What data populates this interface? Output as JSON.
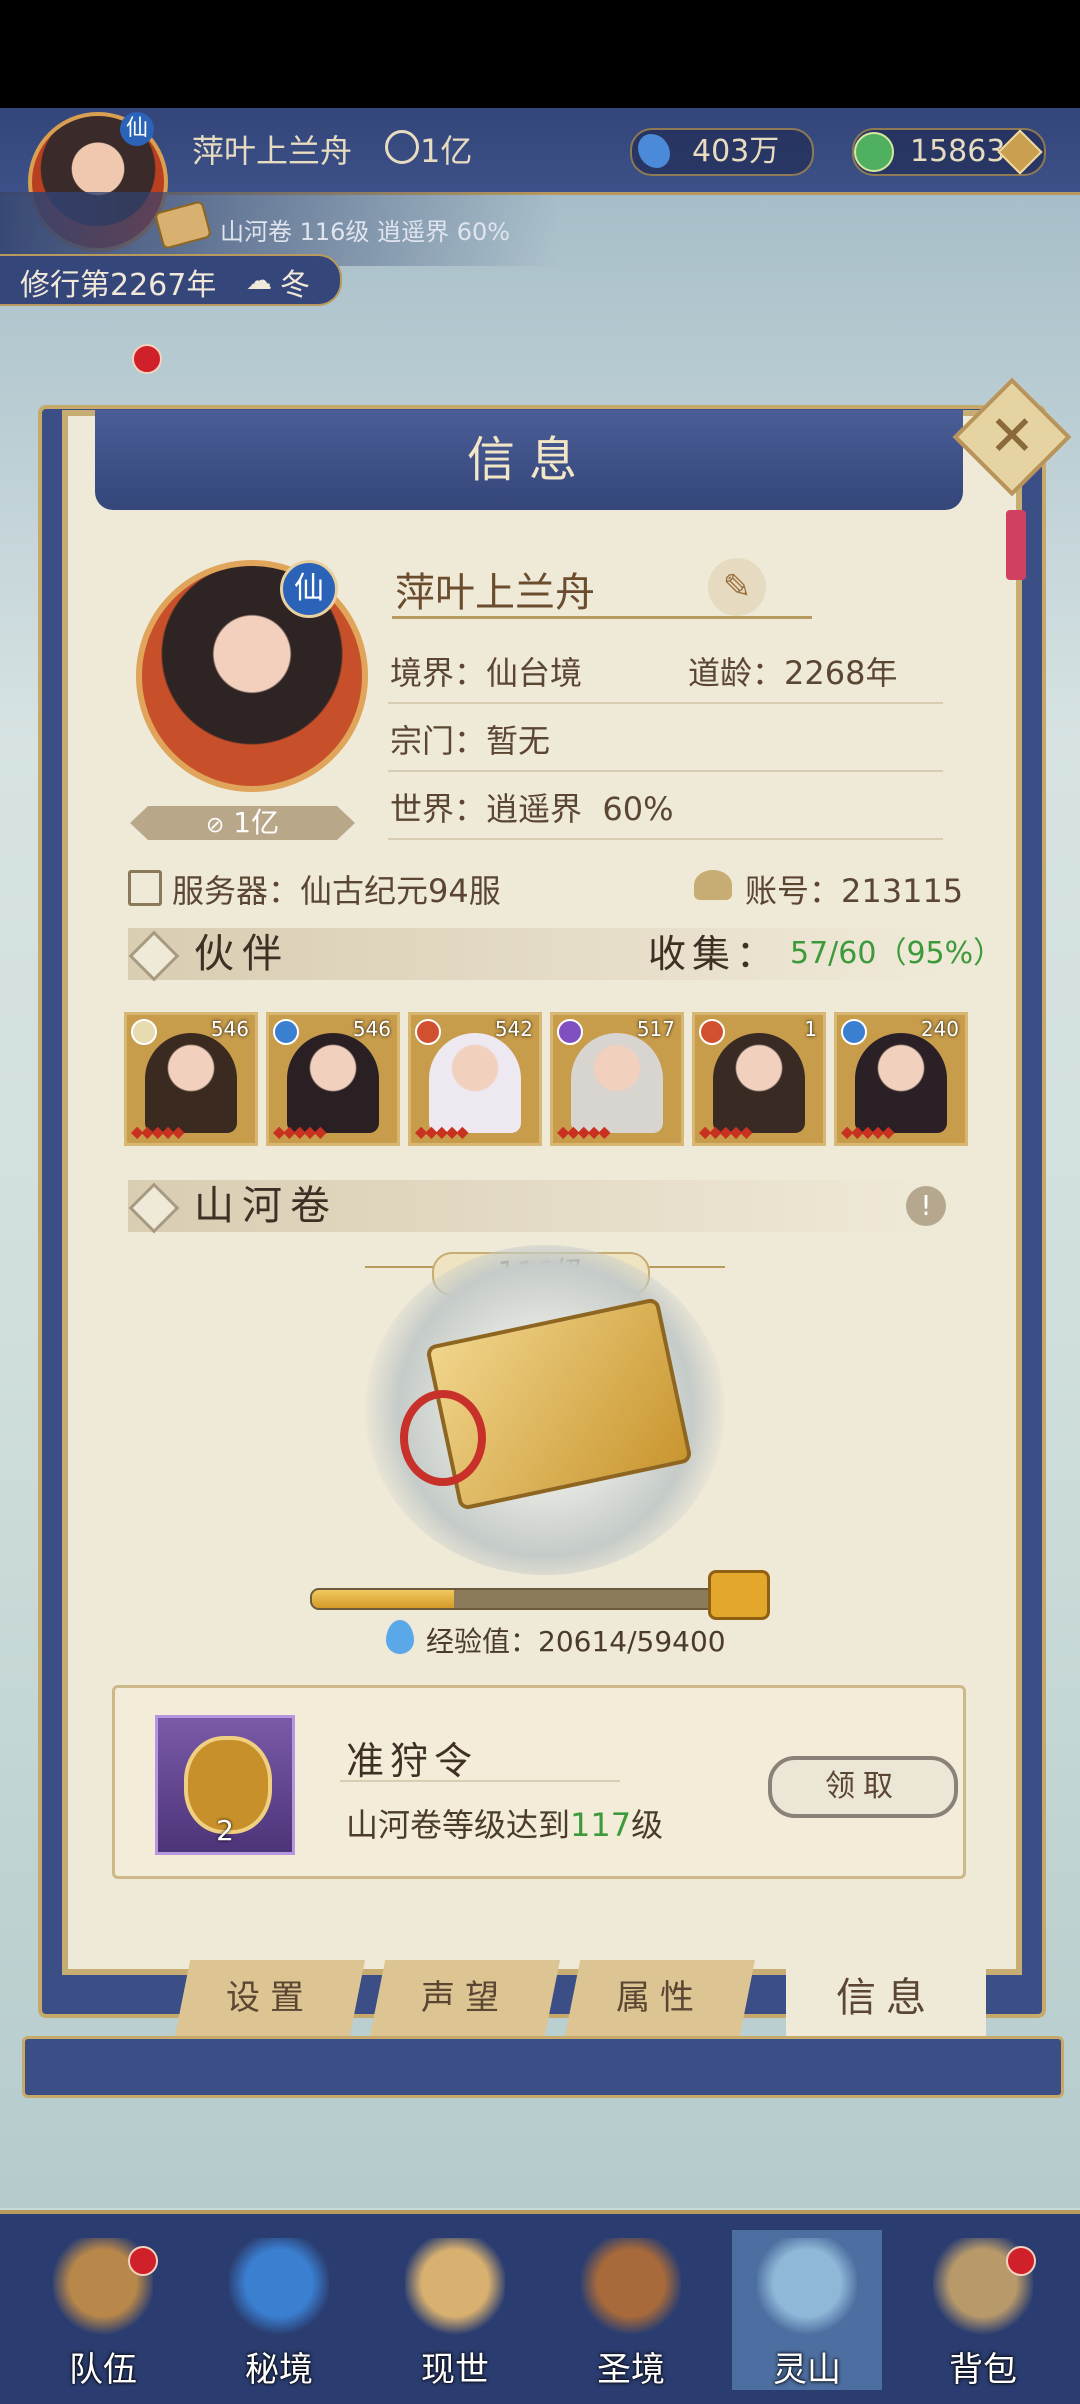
{
  "topbar": {
    "player_name": "萍叶上兰舟",
    "power": "1亿",
    "currency1": "403万",
    "currency2": "15863",
    "subline": "山河卷 116级 逍遥界 60%",
    "year": "修行第2267年",
    "season": "冬",
    "avatar_badge": "仙"
  },
  "panel": {
    "title": "信息",
    "name": "萍叶上兰舟",
    "realm_label": "境界：仙台境",
    "age_label": "道龄：2268年",
    "sect_label": "宗门：暂无",
    "world_label": "世界：逍遥界",
    "world_pct": "60%",
    "power_tag": "1亿",
    "server_label": "服务器：仙古纪元94服",
    "account_label": "账号：213115",
    "partners_title": "伙伴",
    "collect_label": "收集：",
    "collect_value": "57/60（95%）",
    "scroll_title": "山河卷",
    "scroll_level": "116级",
    "exp_label": "经验值：20614/59400",
    "exp_fraction": 0.347,
    "reward_title": "准狩令",
    "reward_desc_a": "山河卷等级达到",
    "reward_desc_level": "117",
    "reward_desc_b": "级",
    "reward_count": "2",
    "claim_button": "领取"
  },
  "partners": [
    {
      "level": "546",
      "element_color": "#e6dcb0",
      "tone": "#3a2a20"
    },
    {
      "level": "546",
      "element_color": "#3a7fd0",
      "tone": "#2a2024"
    },
    {
      "level": "542",
      "element_color": "#d05030",
      "tone": "#eee8f0"
    },
    {
      "level": "517",
      "element_color": "#8050c0",
      "tone": "#d8d4d0"
    },
    {
      "level": "1",
      "element_color": "#d05030",
      "tone": "#3a2a24"
    },
    {
      "level": "240",
      "element_color": "#3a7fd0",
      "tone": "#2a2026"
    }
  ],
  "tabs": [
    {
      "label": "设置"
    },
    {
      "label": "声望"
    },
    {
      "label": "属性"
    },
    {
      "label": "信息"
    }
  ],
  "nav": [
    {
      "label": "队伍",
      "icon": "team-icon",
      "color": "#b8874a"
    },
    {
      "label": "秘境",
      "icon": "secret-realm-icon",
      "color": "#3a7fd0"
    },
    {
      "label": "现世",
      "icon": "world-scroll-icon",
      "color": "#d8b070"
    },
    {
      "label": "圣境",
      "icon": "holy-palace-icon",
      "color": "#a86a3a"
    },
    {
      "label": "灵山",
      "icon": "spirit-mountain-icon",
      "color": "#8fb8d8"
    },
    {
      "label": "背包",
      "icon": "bag-icon",
      "color": "#b89a6a"
    }
  ]
}
